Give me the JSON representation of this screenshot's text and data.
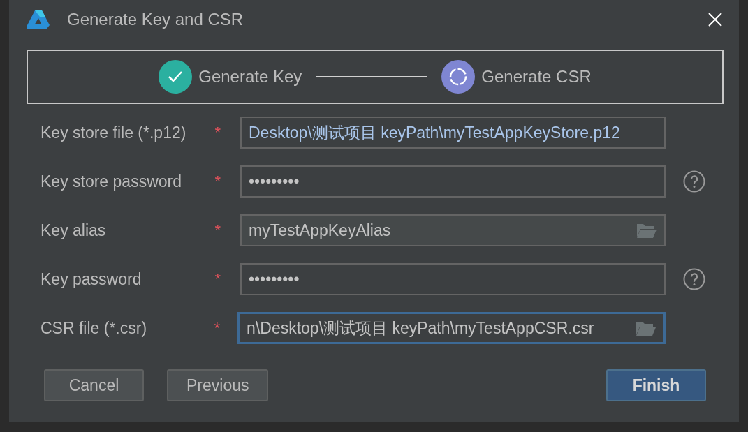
{
  "window": {
    "title": "Generate Key and CSR"
  },
  "steps": [
    {
      "label": "Generate Key",
      "completed": true
    },
    {
      "label": "Generate CSR",
      "completed": false
    }
  ],
  "fields": [
    {
      "label": "Key store file (*.p12)",
      "required_mark": "*",
      "kind": "text",
      "value": "Desktop\\测试项目 keyPath\\myTestAppKeyStore.p12",
      "browse": false,
      "help": false,
      "focused": false
    },
    {
      "label": "Key store password",
      "required_mark": "*",
      "kind": "password",
      "value": "•••••••••",
      "browse": false,
      "help": true,
      "focused": false
    },
    {
      "label": "Key alias",
      "required_mark": "*",
      "kind": "combo",
      "value": "myTestAppKeyAlias",
      "browse": true,
      "help": false,
      "focused": false
    },
    {
      "label": "Key password",
      "required_mark": "*",
      "kind": "password",
      "value": "•••••••••",
      "browse": false,
      "help": true,
      "focused": false
    },
    {
      "label": "CSR file (*.csr)",
      "required_mark": "*",
      "kind": "text",
      "value": "n\\Desktop\\测试项目 keyPath\\myTestAppCSR.csr",
      "browse": true,
      "help": false,
      "focused": true
    }
  ],
  "buttons": [
    {
      "label": "Cancel",
      "primary": false
    },
    {
      "label": "Previous",
      "primary": false
    },
    {
      "label": "Finish",
      "primary": true
    }
  ]
}
